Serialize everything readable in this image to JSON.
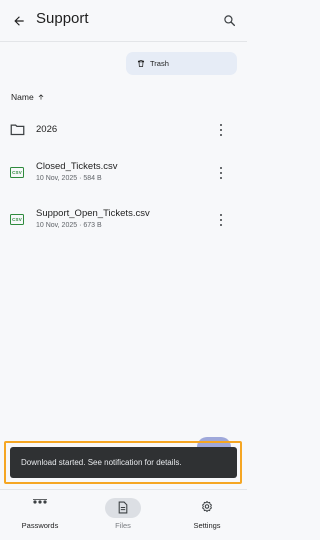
{
  "header": {
    "title": "Support",
    "back_icon": "arrow-left-icon",
    "search_icon": "search-icon"
  },
  "trash": {
    "label": "Trash",
    "icon": "trash-icon"
  },
  "sort": {
    "label": "Name",
    "direction_icon": "arrow-up-icon"
  },
  "items": [
    {
      "name": "2026",
      "meta": "",
      "icon": "folder-icon"
    },
    {
      "name": "Closed_Tickets.csv",
      "meta": "10 Nov, 2025 · 584 B",
      "icon": "csv-icon"
    },
    {
      "name": "Support_Open_Tickets.csv",
      "meta": "10 Nov, 2025 · 673 B",
      "icon": "csv-icon"
    }
  ],
  "csv_badge": "CSV",
  "snackbar": {
    "message": "Download started. See notification for details."
  },
  "highlight_color": "#f5a623",
  "nav": [
    {
      "label": "Passwords",
      "icon": "dots-icon"
    },
    {
      "label": "Files",
      "icon": "document-icon",
      "active": true
    },
    {
      "label": "Settings",
      "icon": "gear-icon"
    }
  ]
}
